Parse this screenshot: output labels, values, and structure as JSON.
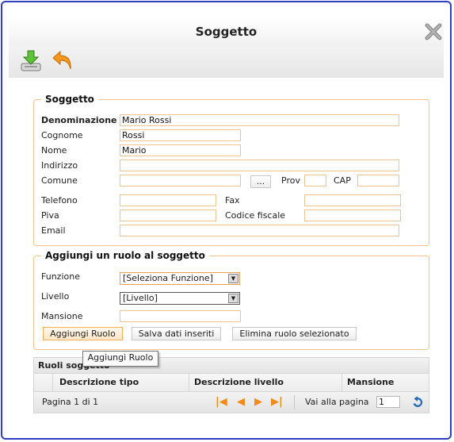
{
  "window": {
    "title": "Soggetto",
    "close_icon": "close-x-icon"
  },
  "toolbar": {
    "items": [
      {
        "icon": "save-download-icon",
        "label": ""
      },
      {
        "icon": "back-undo-icon",
        "label": ""
      }
    ]
  },
  "soggetto": {
    "legend": "Soggetto",
    "denominazione_label": "Denominazione",
    "denominazione_value": "Mario Rossi",
    "cognome_label": "Cognome",
    "cognome_value": "Rossi",
    "nome_label": "Nome",
    "nome_value": "Mario",
    "indirizzo_label": "Indirizzo",
    "indirizzo_value": "",
    "comune_label": "Comune",
    "comune_value": "",
    "comune_lookup_label": "...",
    "prov_label": "Prov",
    "prov_value": "",
    "cap_label": "CAP",
    "cap_value": "",
    "telefono_label": "Telefono",
    "telefono_value": "",
    "fax_label": "Fax",
    "fax_value": "",
    "piva_label": "Piva",
    "piva_value": "",
    "codice_fiscale_label": "Codice fiscale",
    "codice_fiscale_value": "",
    "email_label": "Email",
    "email_value": ""
  },
  "ruolo": {
    "legend": "Aggiungi un ruolo al soggetto",
    "funzione_label": "Funzione",
    "funzione_selected": "[Seleziona Funzione]",
    "livello_label": "Livello",
    "livello_selected": "[Livello]",
    "mansione_label": "Mansione",
    "mansione_value": "",
    "buttons": {
      "aggiungi": "Aggiungi Ruolo",
      "salva": "Salva dati inseriti",
      "elimina": "Elimina ruolo selezionato"
    },
    "tooltip": "Aggiungi Ruolo"
  },
  "grid": {
    "caption": "Ruoli soggetto",
    "columns": [
      "Descrizione tipo",
      "Descrizione livello",
      "Mansione"
    ],
    "pager": {
      "page_info": "Pagina 1 di 1",
      "goto_label": "Vai alla pagina",
      "goto_value": "1"
    }
  },
  "colors": {
    "accent_orange": "#f28b1a",
    "field_border": "#f0c48f",
    "frame_blue": "#2f3fbf",
    "refresh_blue": "#2a6fb5"
  }
}
